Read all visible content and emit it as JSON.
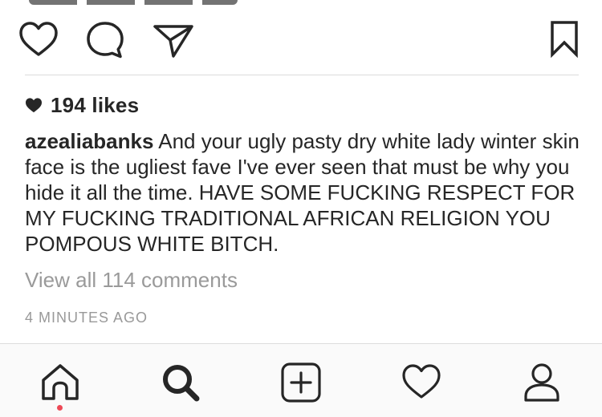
{
  "post": {
    "likes_text": "194 likes",
    "username": "azealiabanks",
    "caption_text": "And your ugly pasty dry white lady winter skin face is the ugliest fave I've ever seen that must be why you hide it all the time. HAVE SOME FUCKING RESPECT FOR MY FUCKING TRADITIONAL AFRICAN RELIGION YOU POMPOUS WHITE BITCH.",
    "view_comments": "View all 114 comments",
    "timestamp": "4 MINUTES AGO"
  },
  "actions": [
    "heart-icon",
    "comment-icon",
    "send-icon",
    "bookmark-icon"
  ],
  "tabs": [
    "home-icon",
    "search-icon",
    "new-post-icon",
    "activity-icon",
    "profile-icon"
  ],
  "colors": {
    "text": "#262626",
    "muted": "#9a9a9a",
    "divider": "#dbdbdb",
    "notification_dot": "#ed4956",
    "tabbar_bg": "#fafafa"
  }
}
